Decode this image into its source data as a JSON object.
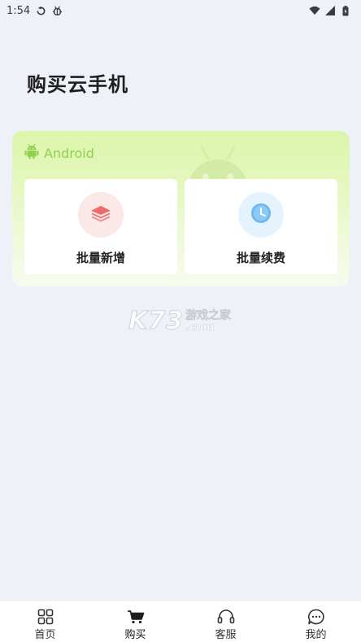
{
  "status_bar": {
    "time": "1:54",
    "left_icons": [
      "sync-icon",
      "bug-icon"
    ],
    "right_icons": [
      "wifi-icon",
      "signal-icon",
      "battery-icon"
    ]
  },
  "page": {
    "title": "购买云手机"
  },
  "android_card": {
    "platform_label": "Android",
    "accent_color": "#8fd14f",
    "actions": [
      {
        "label": "批量新增",
        "icon": "layers-icon",
        "color": "#ef6a6a"
      },
      {
        "label": "批量续费",
        "icon": "clock-icon",
        "color": "#6bb6f0"
      }
    ]
  },
  "watermark": {
    "main": "K73",
    "cn": "游戏之家",
    "suffix": ".com"
  },
  "tab_bar": {
    "tabs": [
      {
        "label": "首页",
        "icon": "grid-icon",
        "active": false
      },
      {
        "label": "购买",
        "icon": "cart-icon",
        "active": true
      },
      {
        "label": "客服",
        "icon": "headset-icon",
        "active": false
      },
      {
        "label": "我的",
        "icon": "chat-icon",
        "active": false
      }
    ]
  }
}
